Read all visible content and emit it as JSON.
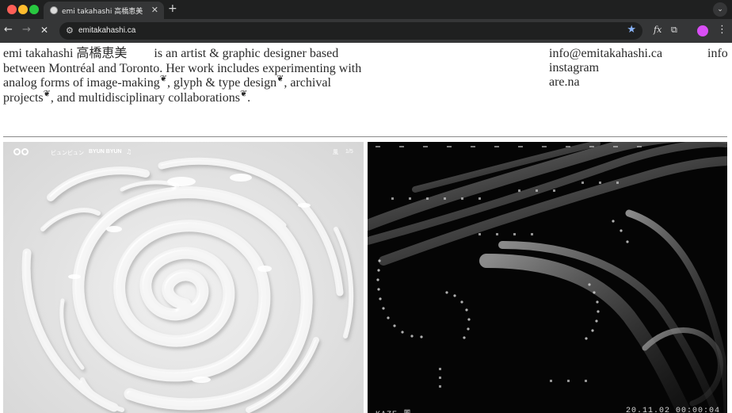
{
  "browser": {
    "tab_title": "emi takahashi 高橋恵美",
    "tab_close": "✕",
    "new_tab": "+",
    "tab_search": "⌄",
    "back": "←",
    "forward": "→",
    "stop": "✕",
    "site_info": "⚙",
    "url": "emitakahashi.ca",
    "bookmark": "★",
    "ext_fx": "fx",
    "ext_puzzle": "⧉",
    "menu": "⋮",
    "colors": {
      "tabbar": "#1f2020",
      "toolbar": "#353637",
      "profile": "#d94ef5",
      "bookmark": "#8ab4f8"
    }
  },
  "header": {
    "name": "emi takahashi 高橋恵美",
    "bio_line1": "is an artist & graphic designer based between Montréal and Toronto. Her work includes experimenting with analog forms of image-making",
    "bio_sep1": ", glyph & type design",
    "bio_sep2": ", archival projects",
    "bio_sep3": ", and multidisciplinary collaborations",
    "bio_end": ".",
    "glyph_icon": "❦",
    "contact_email": "info@emitakahashi.ca",
    "contact_instagram": "instagram",
    "contact_arena": "are.na",
    "info_link": "info"
  },
  "projects": {
    "left": {
      "title_jp": "ビュンビュン",
      "title_en": "BYUN BYUN",
      "note_icon": "♫",
      "kanji": "風",
      "counter": "1/5"
    },
    "right": {
      "label": "KAZE 風",
      "date": "20.11.02  00:00:04"
    }
  }
}
